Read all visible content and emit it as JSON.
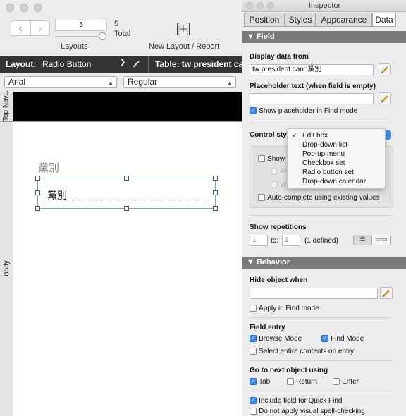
{
  "main": {
    "record_number": "5",
    "total_count": "5",
    "total_label": "Total",
    "layouts_label": "Layouts",
    "new_layout_label": "New Layout / Report",
    "layout_label": "Layout:",
    "layout_name": "Radio Button",
    "table_label": "Table: tw president can",
    "font_name": "Arial",
    "font_style": "Regular",
    "part_top_nav": "Top Nav...",
    "part_body": "Body",
    "field_label_text": "黨別",
    "field_content": "黨別"
  },
  "inspector": {
    "title": "Inspector",
    "tabs": [
      "Position",
      "Styles",
      "Appearance",
      "Data"
    ],
    "field_section": {
      "header": "Field",
      "display_data_from_label": "Display data from",
      "display_data_value": "tw president can::黨別",
      "placeholder_label": "Placeholder text (when field is empty)",
      "placeholder_value": "",
      "show_placeholder_label": "Show placeholder in Find mode",
      "control_style_label": "Control styl",
      "show_label": "Show v",
      "radio1_label": "Alw",
      "radio2_label": "W",
      "autocomplete_label": "Auto-complete using existing values",
      "show_repetitions_label": "Show repetitions",
      "rep_from": "1",
      "rep_to_label": "to:",
      "rep_to": "1",
      "rep_defined": "(1 defined)"
    },
    "control_menu": [
      "Edit box",
      "Drop-down list",
      "Pop-up menu",
      "Checkbox set",
      "Radio button set",
      "Drop-down calendar"
    ],
    "behavior_section": {
      "header": "Behavior",
      "hide_when_label": "Hide object when",
      "hide_value": "",
      "apply_find_label": "Apply in Find mode",
      "field_entry_label": "Field entry",
      "browse_mode_label": "Browse Mode",
      "find_mode_label": "Find Mode",
      "select_entire_label": "Select entire contents on entry",
      "go_next_label": "Go to next object using",
      "tab_label": "Tab",
      "return_label": "Return",
      "enter_label": "Enter",
      "quick_find_label": "Include field for Quick Find",
      "spell_label": "Do not apply visual spell-checking"
    }
  }
}
